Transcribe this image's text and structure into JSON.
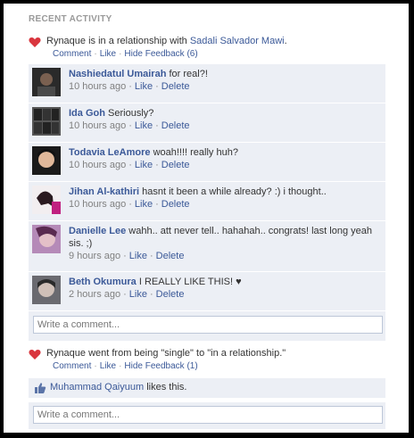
{
  "section_title": "RECENT ACTIVITY",
  "story1": {
    "text": "Rynaque is in a relationship with ",
    "partner": "Sadali Salvador Mawi",
    "end": ".",
    "comment_label": "Comment",
    "like_label": "Like",
    "hide_label": "Hide Feedback (6)"
  },
  "comments": [
    {
      "author": "Nashiedatul Umairah",
      "text": "for real?!",
      "time": "10 hours ago",
      "like": "Like",
      "delete": "Delete"
    },
    {
      "author": "Ida Goh",
      "text": "Seriously?",
      "time": "10 hours ago",
      "like": "Like",
      "delete": "Delete"
    },
    {
      "author": "Todavia LeAmore",
      "text": "woah!!!! really huh?",
      "time": "10 hours ago",
      "like": "Like",
      "delete": "Delete"
    },
    {
      "author": "Jihan Al-kathiri",
      "text": "hasnt it been a while already? :) i thought..",
      "time": "10 hours ago",
      "like": "Like",
      "delete": "Delete"
    },
    {
      "author": "Danielle Lee",
      "text": "wahh.. att never tell.. hahahah.. congrats! last long yeah sis. ;)",
      "time": "9 hours ago",
      "like": "Like",
      "delete": "Delete"
    },
    {
      "author": "Beth Okumura",
      "text": "I REALLY LIKE THIS! ♥",
      "time": "2 hours ago",
      "like": "Like",
      "delete": "Delete"
    }
  ],
  "comment_input_placeholder": "Write a comment...",
  "story2": {
    "text": "Rynaque went from being \"single\" to \"in a relationship.\"",
    "comment_label": "Comment",
    "like_label": "Like",
    "hide_label": "Hide Feedback (1)"
  },
  "likes": {
    "name": "Muhammad Qaiyuum",
    "suffix": " likes this."
  },
  "comment_input2_placeholder": "Write a comment..."
}
